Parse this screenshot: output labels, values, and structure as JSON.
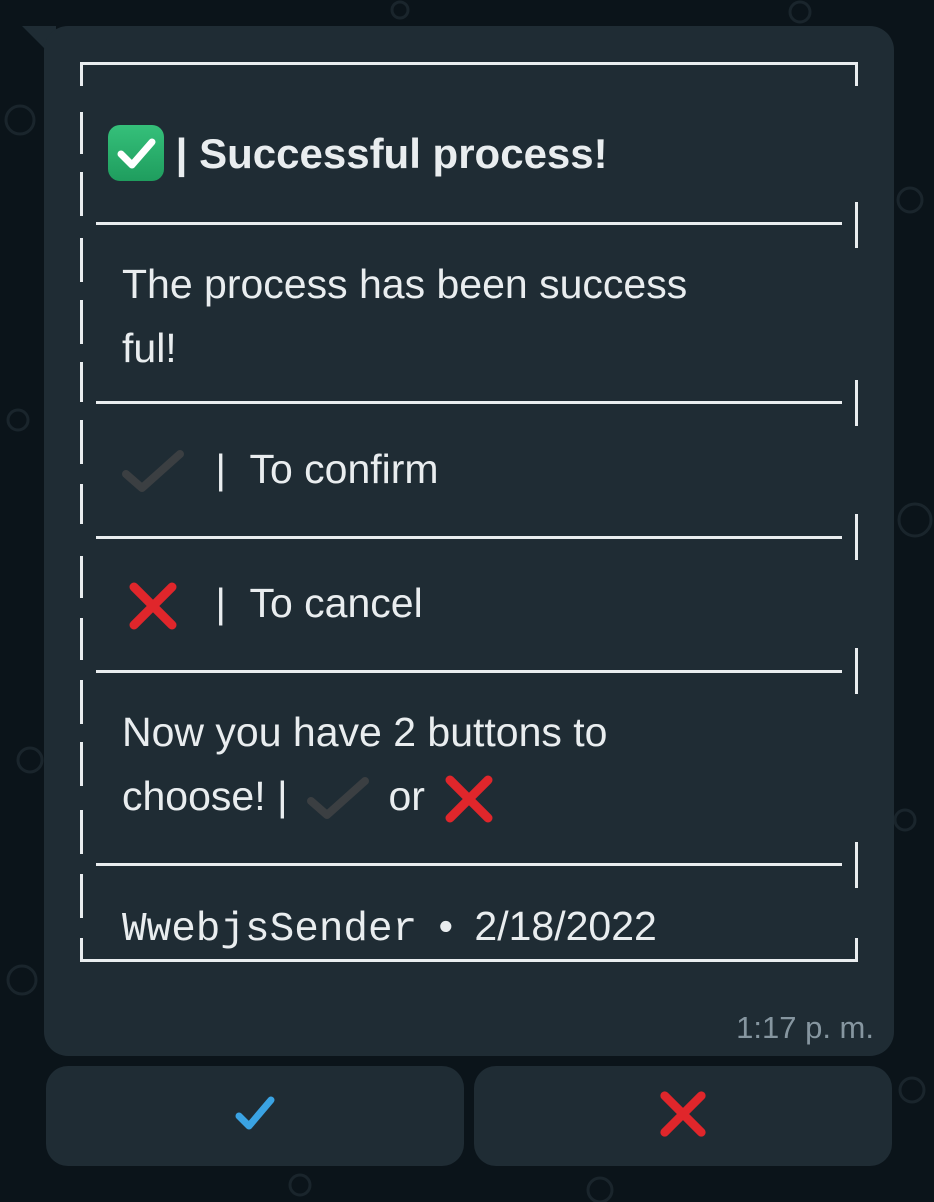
{
  "message": {
    "title_separator": "|",
    "title": "Successful process!",
    "body_line1": "The process has been success",
    "body_line2": "ful!",
    "confirm_separator": "|",
    "confirm_label": "To confirm",
    "cancel_separator": "|",
    "cancel_label": "To cancel",
    "choose_line1": "Now you have 2 buttons to",
    "choose_line2_prefix": "choose! |",
    "choose_or": "or",
    "footer_sender": "WwebjsSender",
    "footer_dot": "•",
    "footer_date": "2/18/2022",
    "timestamp": "1:17 p. m."
  },
  "buttons": [
    {
      "icon": "blue-check-icon"
    },
    {
      "icon": "red-cross-icon"
    }
  ],
  "colors": {
    "background": "#0b141a",
    "bubble": "#1f2c34",
    "text": "#e9edef",
    "timestamp": "#8696a0",
    "check_blue": "#3aa3e3",
    "cross_red": "#e0262b",
    "emoji_green": "#2db26d"
  }
}
